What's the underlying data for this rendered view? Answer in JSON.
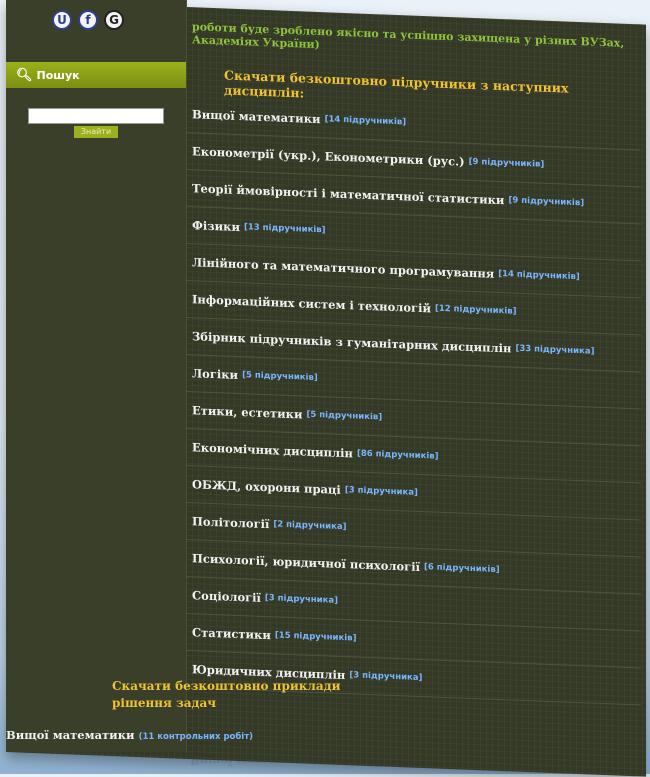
{
  "social": {
    "icons": [
      {
        "name": "vk-icon",
        "glyph": "U"
      },
      {
        "name": "facebook-icon",
        "glyph": "f"
      },
      {
        "name": "google-icon",
        "glyph": "G"
      }
    ]
  },
  "sidebar": {
    "search_title": "Пошук",
    "search_placeholder": "",
    "search_button": "Знайти"
  },
  "content": {
    "top_note": "роботи буде зроблено якісно та успішно захищена у різних ВУЗах, Академіях України)",
    "heading": "Скачати безкоштовно підручники з наступних дисциплін:",
    "disciplines": [
      {
        "title": "Вищої математики",
        "count": "[14 підручників]"
      },
      {
        "title": "Економетрії (укр.), Економетрики (рус.)",
        "count": "[9 підручників]"
      },
      {
        "title": "Теорії ймовірності і математичної статистики",
        "count": "[9 підручників]"
      },
      {
        "title": "Фізики",
        "count": "[13 підручників]"
      },
      {
        "title": "Лінійного та математичного програмування",
        "count": "[14 підручників]"
      },
      {
        "title": "Інформаційних систем і технологій",
        "count": "[12 підручників]"
      },
      {
        "title": "Збірник підручників з гуманітарних дисциплін",
        "count": "[33 підручника]"
      },
      {
        "title": "Логіки",
        "count": "[5 підручників]"
      },
      {
        "title": "Етики, естетики",
        "count": "[5 підручників]"
      },
      {
        "title": "Економічних дисциплін",
        "count": "[86 підручників]"
      },
      {
        "title": "ОБЖД, охорони праці",
        "count": "[3 підручника]"
      },
      {
        "title": "Політології",
        "count": "[2 підручника]"
      },
      {
        "title": "Психології, юридичної психології",
        "count": "[6 підручників]"
      },
      {
        "title": "Соціології",
        "count": "[3 підручника]"
      },
      {
        "title": "Статистики",
        "count": "[15 підручників]"
      },
      {
        "title": "Юридичних дисциплін",
        "count": "[3 підручника]"
      }
    ],
    "heading2": "Скачати безкоштовно приклади рішення задач",
    "last_item": {
      "title": "Вищої математики",
      "count": "(11 контрольних робіт)"
    }
  }
}
